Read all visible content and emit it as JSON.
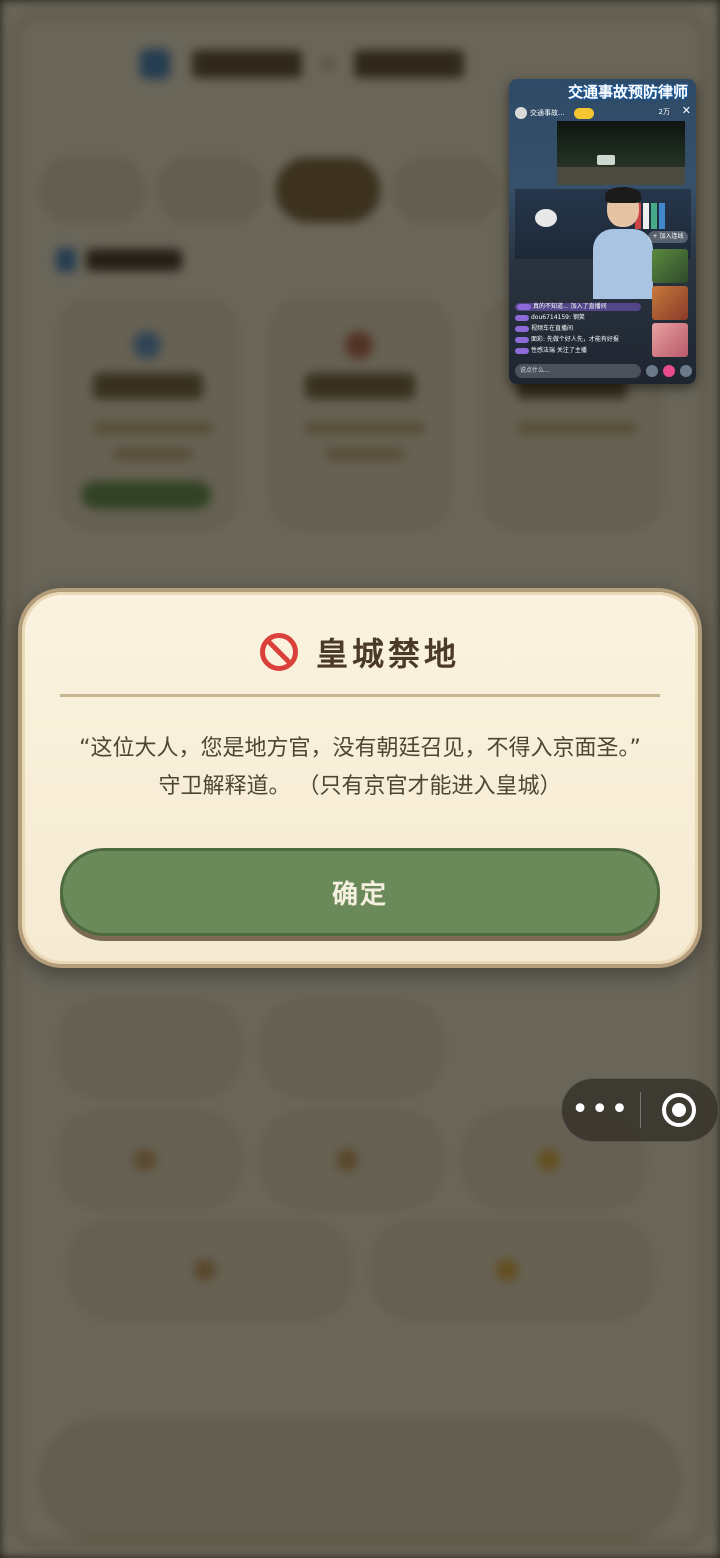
{
  "dialog": {
    "title": "皇城禁地",
    "message": "“这位大人，您是地方官，没有朝廷召见，不得入京面圣。” 守卫解释道。 （只有京官才能进入皇城）",
    "confirm_label": "确定",
    "icon": "forbidden-icon",
    "accent_color": "#d9413a",
    "button_color": "#6b8a5a"
  },
  "live_window": {
    "title": "交通事故预防律师",
    "host_name": "交通事故...",
    "viewers": "2万",
    "chat": [
      "真的不知道... 加入了直播间",
      "dou6714159: 钢笑",
      "视频车在直播间",
      "面彩: 先做个好人先，才能有好报",
      "性感法瑞 关注了主播"
    ],
    "join_label": "+ 加入连线",
    "input_placeholder": "说点什么..."
  },
  "capsule": {
    "more_icon": "more-dots-icon",
    "close_icon": "close-target-icon"
  }
}
